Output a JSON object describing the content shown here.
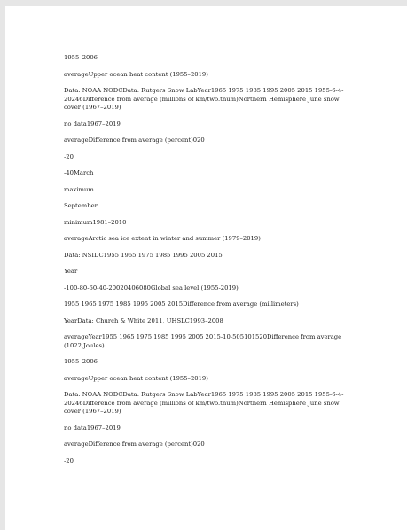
{
  "document": {
    "paragraphs": [
      "1955–2006",
      "averageUpper ocean heat content (1955–2019)",
      "Data: NOAA NODCData: Rutgers Snow LabYear1965 1975 1985 1995 2005 2015 1955-6-4-20246Difference from average (millions of km/two.tnum)Northern Hemisphere June snow cover (1967–2019)",
      "no data1967–2019",
      "averageDifference from average (percent)020",
      "-20",
      "-40March",
      "maximum",
      "September",
      "minimum1981–2010",
      "averageArctic sea ice extent in winter and summer (1979–2019)",
      "Data: NSIDC1955 1965 1975 1985 1995 2005 2015",
      "Year",
      "-100-80-60-40-20020406080Global sea level (1955-2019)",
      "1955 1965 1975 1985 1995 2005 2015Difference from average (millimeters)",
      "YearData: Church & White 2011, UHSLC1993–2008",
      "averageYear1955 1965 1975 1985 1995 2005 2015-10-505101520Difference from average (1022 Joules)",
      "1955–2006",
      "averageUpper ocean heat content (1955–2019)",
      "Data: NOAA NODCData: Rutgers Snow LabYear1965 1975 1985 1995 2005 2015 1955-6-4-20246Difference from average (millions of km/two.tnum)Northern Hemisphere June snow cover (1967–2019)",
      "no data1967–2019",
      "averageDifference from average (percent)020",
      "-20"
    ]
  }
}
